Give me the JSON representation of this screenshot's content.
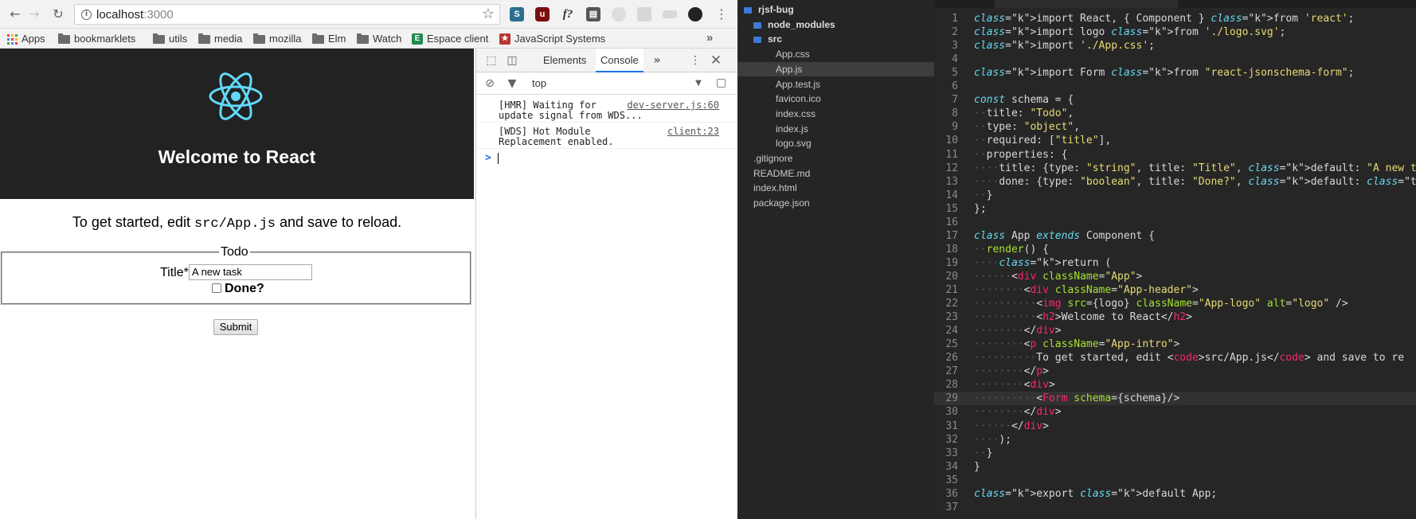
{
  "browser": {
    "url_host": "localhost",
    "url_port": ":3000",
    "bookmarks": [
      {
        "label": "Apps",
        "icon": "apps-grid-icon"
      },
      {
        "label": "bookmarklets",
        "icon": "folder-icon"
      },
      {
        "label": "utils",
        "icon": "folder-icon"
      },
      {
        "label": "media",
        "icon": "folder-icon"
      },
      {
        "label": "mozilla",
        "icon": "folder-icon"
      },
      {
        "label": "Elm",
        "icon": "folder-icon"
      },
      {
        "label": "Watch",
        "icon": "folder-icon"
      },
      {
        "label": "Espace client",
        "icon": "espace-client-favicon"
      },
      {
        "label": "JavaScript Systems",
        "icon": "javascript-systems-favicon"
      }
    ],
    "bookmarks_more": "»"
  },
  "page": {
    "header_title": "Welcome to React",
    "intro_before": "To get started, edit ",
    "intro_code": "src/App.js",
    "intro_after": " and save to reload.",
    "form_legend": "Todo",
    "title_label": "Title*",
    "title_value": "A new task",
    "done_label": "Done?",
    "submit_label": "Submit"
  },
  "devtools": {
    "tabs": [
      "Elements",
      "Console"
    ],
    "active_tab": "Console",
    "context": "top",
    "messages": [
      {
        "text": "[HMR] Waiting for\nupdate signal from WDS...",
        "source": "dev-server.js:60"
      },
      {
        "text": "[WDS] Hot Module\nReplacement enabled.",
        "source": "client:23"
      }
    ],
    "prompt": ">"
  },
  "editor": {
    "tree": [
      {
        "label": "rjsf-bug",
        "level": 0,
        "type": "folder-root"
      },
      {
        "label": "node_modules",
        "level": 1,
        "type": "folder"
      },
      {
        "label": "src",
        "level": 1,
        "type": "folder-open"
      },
      {
        "label": "App.css",
        "level": 2,
        "type": "file"
      },
      {
        "label": "App.js",
        "level": 2,
        "type": "file",
        "selected": true
      },
      {
        "label": "App.test.js",
        "level": 2,
        "type": "file"
      },
      {
        "label": "favicon.ico",
        "level": 2,
        "type": "file"
      },
      {
        "label": "index.css",
        "level": 2,
        "type": "file"
      },
      {
        "label": "index.js",
        "level": 2,
        "type": "file"
      },
      {
        "label": "logo.svg",
        "level": 2,
        "type": "file"
      },
      {
        "label": ".gitignore",
        "level": 1,
        "type": "file"
      },
      {
        "label": "README.md",
        "level": 1,
        "type": "file"
      },
      {
        "label": "index.html",
        "level": 1,
        "type": "file"
      },
      {
        "label": "package.json",
        "level": 1,
        "type": "file"
      }
    ],
    "code_lines": [
      "import React, { Component } from 'react';",
      "import logo from './logo.svg';",
      "import './App.css';",
      "",
      "import Form from \"react-jsonschema-form\";",
      "",
      "const schema = {",
      "  title: \"Todo\",",
      "  type: \"object\",",
      "  required: [\"title\"],",
      "  properties: {",
      "    title: {type: \"string\", title: \"Title\", default: \"A new task\"},",
      "    done: {type: \"boolean\", title: \"Done?\", default: false}",
      "  }",
      "};",
      "",
      "class App extends Component {",
      "  render() {",
      "    return (",
      "      <div className=\"App\">",
      "        <div className=\"App-header\">",
      "          <img src={logo} className=\"App-logo\" alt=\"logo\" />",
      "          <h2>Welcome to React</h2>",
      "        </div>",
      "        <p className=\"App-intro\">",
      "          To get started, edit <code>src/App.js</code> and save to re",
      "        </p>",
      "        <div>",
      "          <Form schema={schema}/>",
      "        </div>",
      "      </div>",
      "    );",
      "  }",
      "}",
      "",
      "export default App;",
      ""
    ],
    "current_line": 29
  },
  "colors": {
    "react_blue": "#61dafb",
    "header_bg": "#222222",
    "editor_keyword": "#f92672",
    "editor_string": "#e6db74",
    "editor_storage": "#66d9ef",
    "editor_attr": "#a6e22e"
  }
}
